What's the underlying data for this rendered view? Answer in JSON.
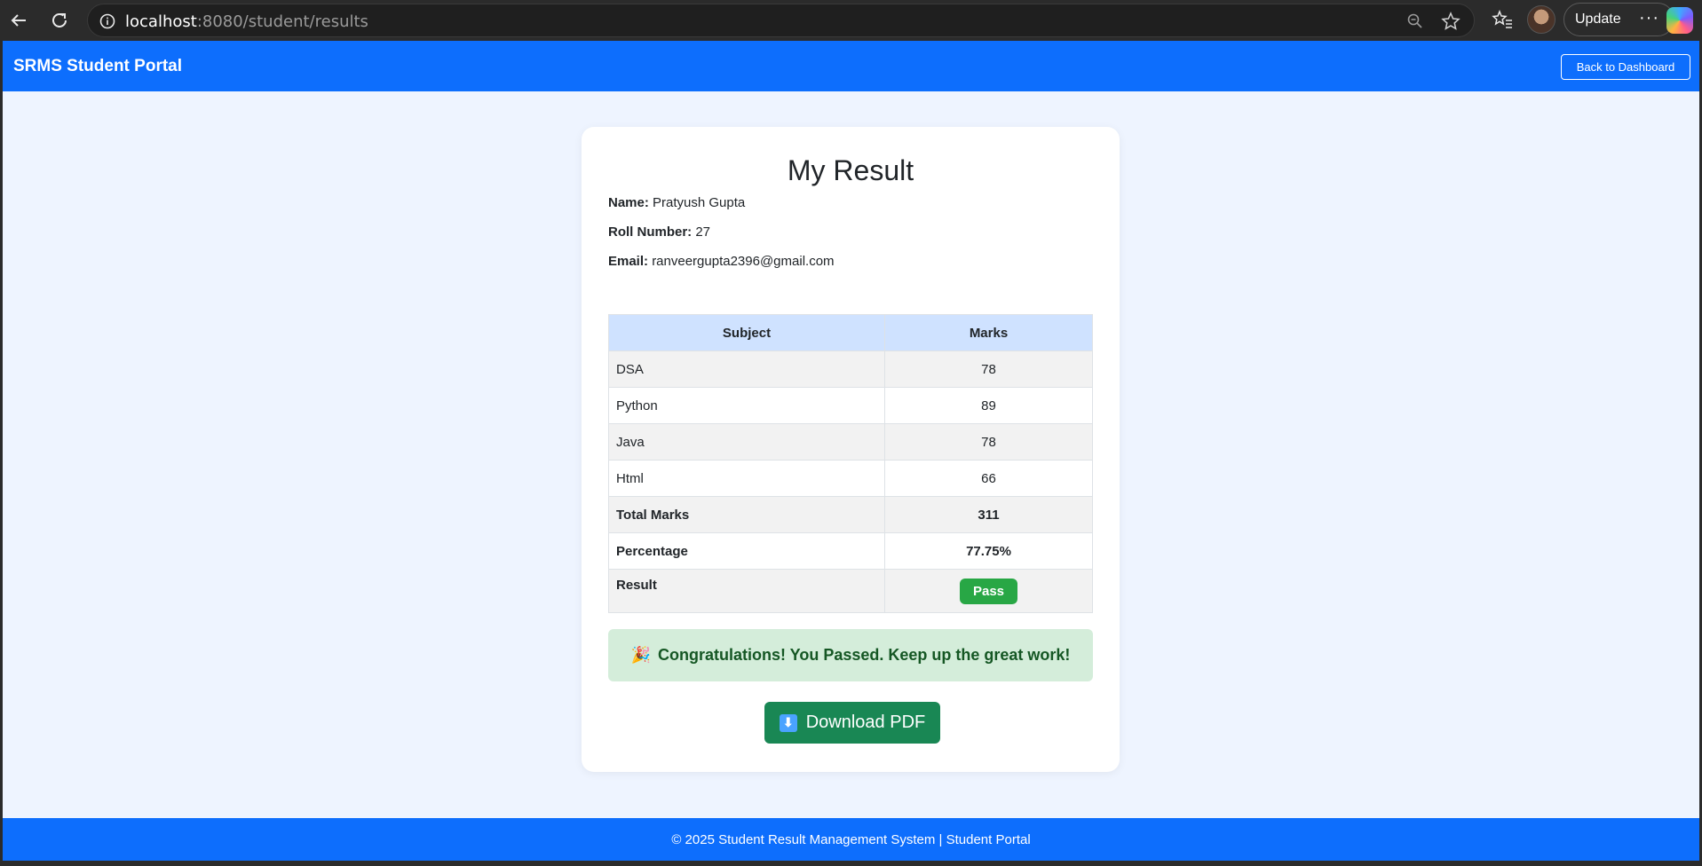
{
  "browser": {
    "url_host": "localhost",
    "url_rest": ":8080/student/results",
    "update_label": "Update",
    "more_label": "···"
  },
  "header": {
    "brand": "SRMS Student Portal",
    "back_label": "Back to Dashboard"
  },
  "result": {
    "title": "My Result",
    "name_label": "Name:",
    "name_value": "Pratyush Gupta",
    "roll_label": "Roll Number:",
    "roll_value": "27",
    "email_label": "Email:",
    "email_value": "ranveergupta2396@gmail.com",
    "table": {
      "headers": [
        "Subject",
        "Marks"
      ],
      "rows": [
        {
          "subject": "DSA",
          "marks": "78"
        },
        {
          "subject": "Python",
          "marks": "89"
        },
        {
          "subject": "Java",
          "marks": "78"
        },
        {
          "subject": "Html",
          "marks": "66"
        }
      ],
      "total_label": "Total Marks",
      "total_value": "311",
      "percentage_label": "Percentage",
      "percentage_value": "77.75%",
      "result_label": "Result",
      "result_value": "Pass"
    },
    "congrats_icon": "🎉",
    "congrats_text": "Congratulations! You Passed. Keep up the great work!",
    "download_icon": "⬇",
    "download_label": "Download PDF"
  },
  "footer": {
    "text": "© 2025 Student Result Management System | Student Portal"
  },
  "colors": {
    "primary": "#0d6efd",
    "page_bg": "#eef4ff",
    "success": "#28a745",
    "download": "#198754",
    "alert_bg": "#d4edda",
    "alert_text": "#155724",
    "table_header_bg": "#cfe2ff"
  }
}
